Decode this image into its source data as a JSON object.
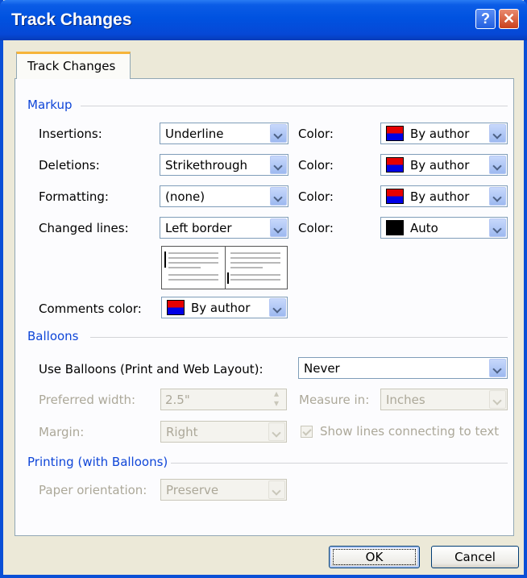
{
  "window": {
    "title": "Track Changes",
    "help_label": "?",
    "close_label": "✕"
  },
  "tab": {
    "label": "Track Changes"
  },
  "markup": {
    "heading": "Markup",
    "rows": [
      {
        "label": "Insertions:",
        "value": "Underline",
        "color_label": "Color:",
        "color_value": "By author",
        "swatch": "author"
      },
      {
        "label": "Deletions:",
        "value": "Strikethrough",
        "color_label": "Color:",
        "color_value": "By author",
        "swatch": "author"
      },
      {
        "label": "Formatting:",
        "value": "(none)",
        "color_label": "Color:",
        "color_value": "By author",
        "swatch": "author"
      },
      {
        "label": "Changed lines:",
        "value": "Left border",
        "color_label": "Color:",
        "color_value": "Auto",
        "swatch": "black"
      }
    ],
    "comments_label": "Comments color:",
    "comments_value": "By author"
  },
  "balloons": {
    "heading": "Balloons",
    "use_label": "Use Balloons (Print and Web Layout):",
    "use_value": "Never",
    "width_label": "Preferred width:",
    "width_value": "2.5\"",
    "measure_label": "Measure in:",
    "measure_value": "Inches",
    "margin_label": "Margin:",
    "margin_value": "Right",
    "show_lines_label": "Show lines connecting to text",
    "show_lines_checked": true
  },
  "printing": {
    "heading": "Printing (with Balloons)",
    "orientation_label": "Paper orientation:",
    "orientation_value": "Preserve"
  },
  "buttons": {
    "ok": "OK",
    "cancel": "Cancel"
  },
  "colors": {
    "title_bar": "#0052e0",
    "section_heading": "#0f46d8",
    "by_author_top": "#e60000",
    "by_author_bottom": "#0000e6"
  }
}
